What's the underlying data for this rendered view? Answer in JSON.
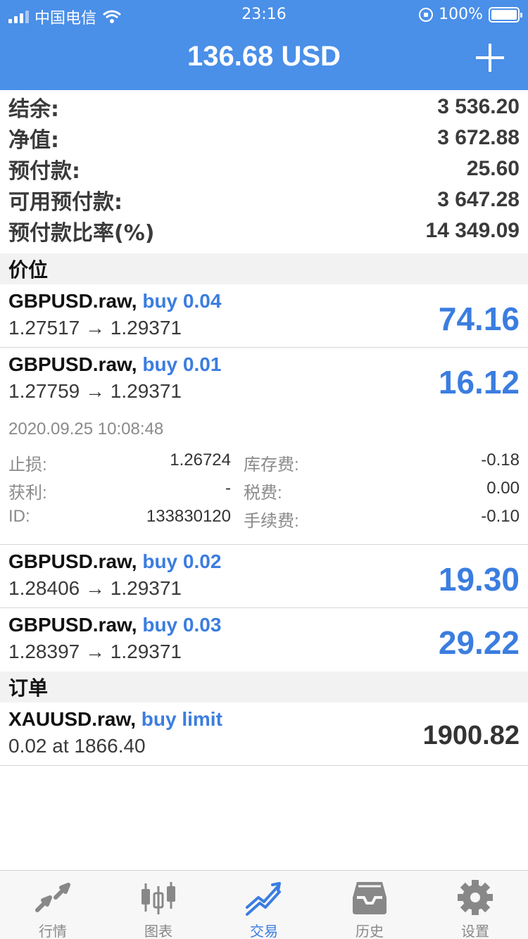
{
  "status_bar": {
    "carrier": "中国电信",
    "time": "23:16",
    "battery": "100%"
  },
  "header": {
    "title": "136.68 USD"
  },
  "summary": [
    {
      "label": "结余:",
      "value": "3 536.20"
    },
    {
      "label": "净值:",
      "value": "3 672.88"
    },
    {
      "label": "预付款:",
      "value": "25.60"
    },
    {
      "label": "可用预付款:",
      "value": "3 647.28"
    },
    {
      "label": "预付款比率(%)",
      "value": "14 349.09"
    }
  ],
  "positions_header": "价位",
  "positions": [
    {
      "symbol": "GBPUSD.raw,",
      "action": "buy 0.04",
      "prices": "1.27517 → 1.29371",
      "profit": "74.16"
    },
    {
      "symbol": "GBPUSD.raw,",
      "action": "buy 0.01",
      "prices": "1.27759 → 1.29371",
      "profit": "16.12"
    },
    {
      "symbol": "GBPUSD.raw,",
      "action": "buy 0.02",
      "prices": "1.28406 → 1.29371",
      "profit": "19.30"
    },
    {
      "symbol": "GBPUSD.raw,",
      "action": "buy 0.03",
      "prices": "1.28397 → 1.29371",
      "profit": "29.22"
    }
  ],
  "details": {
    "date": "2020.09.25 10:08:48",
    "rows": [
      {
        "l1": "止损:",
        "v1": "1.26724",
        "l2": "库存费:",
        "v2": "-0.18"
      },
      {
        "l1": "获利:",
        "v1": "-",
        "l2": "税费:",
        "v2": "0.00"
      },
      {
        "l1": "ID:",
        "v1": "133830120",
        "l2": "手续费:",
        "v2": "-0.10"
      }
    ]
  },
  "orders_header": "订单",
  "orders": [
    {
      "symbol": "XAUUSD.raw,",
      "action": "buy limit",
      "prices": "0.02 at 1866.40",
      "price": "1900.82"
    }
  ],
  "tabs": [
    {
      "label": "行情",
      "icon": "quotes-icon"
    },
    {
      "label": "图表",
      "icon": "chart-icon"
    },
    {
      "label": "交易",
      "icon": "trade-icon",
      "active": true
    },
    {
      "label": "历史",
      "icon": "history-icon"
    },
    {
      "label": "设置",
      "icon": "settings-icon"
    }
  ],
  "colors": {
    "header": "#4a8fe8",
    "accent": "#3b7de0"
  }
}
